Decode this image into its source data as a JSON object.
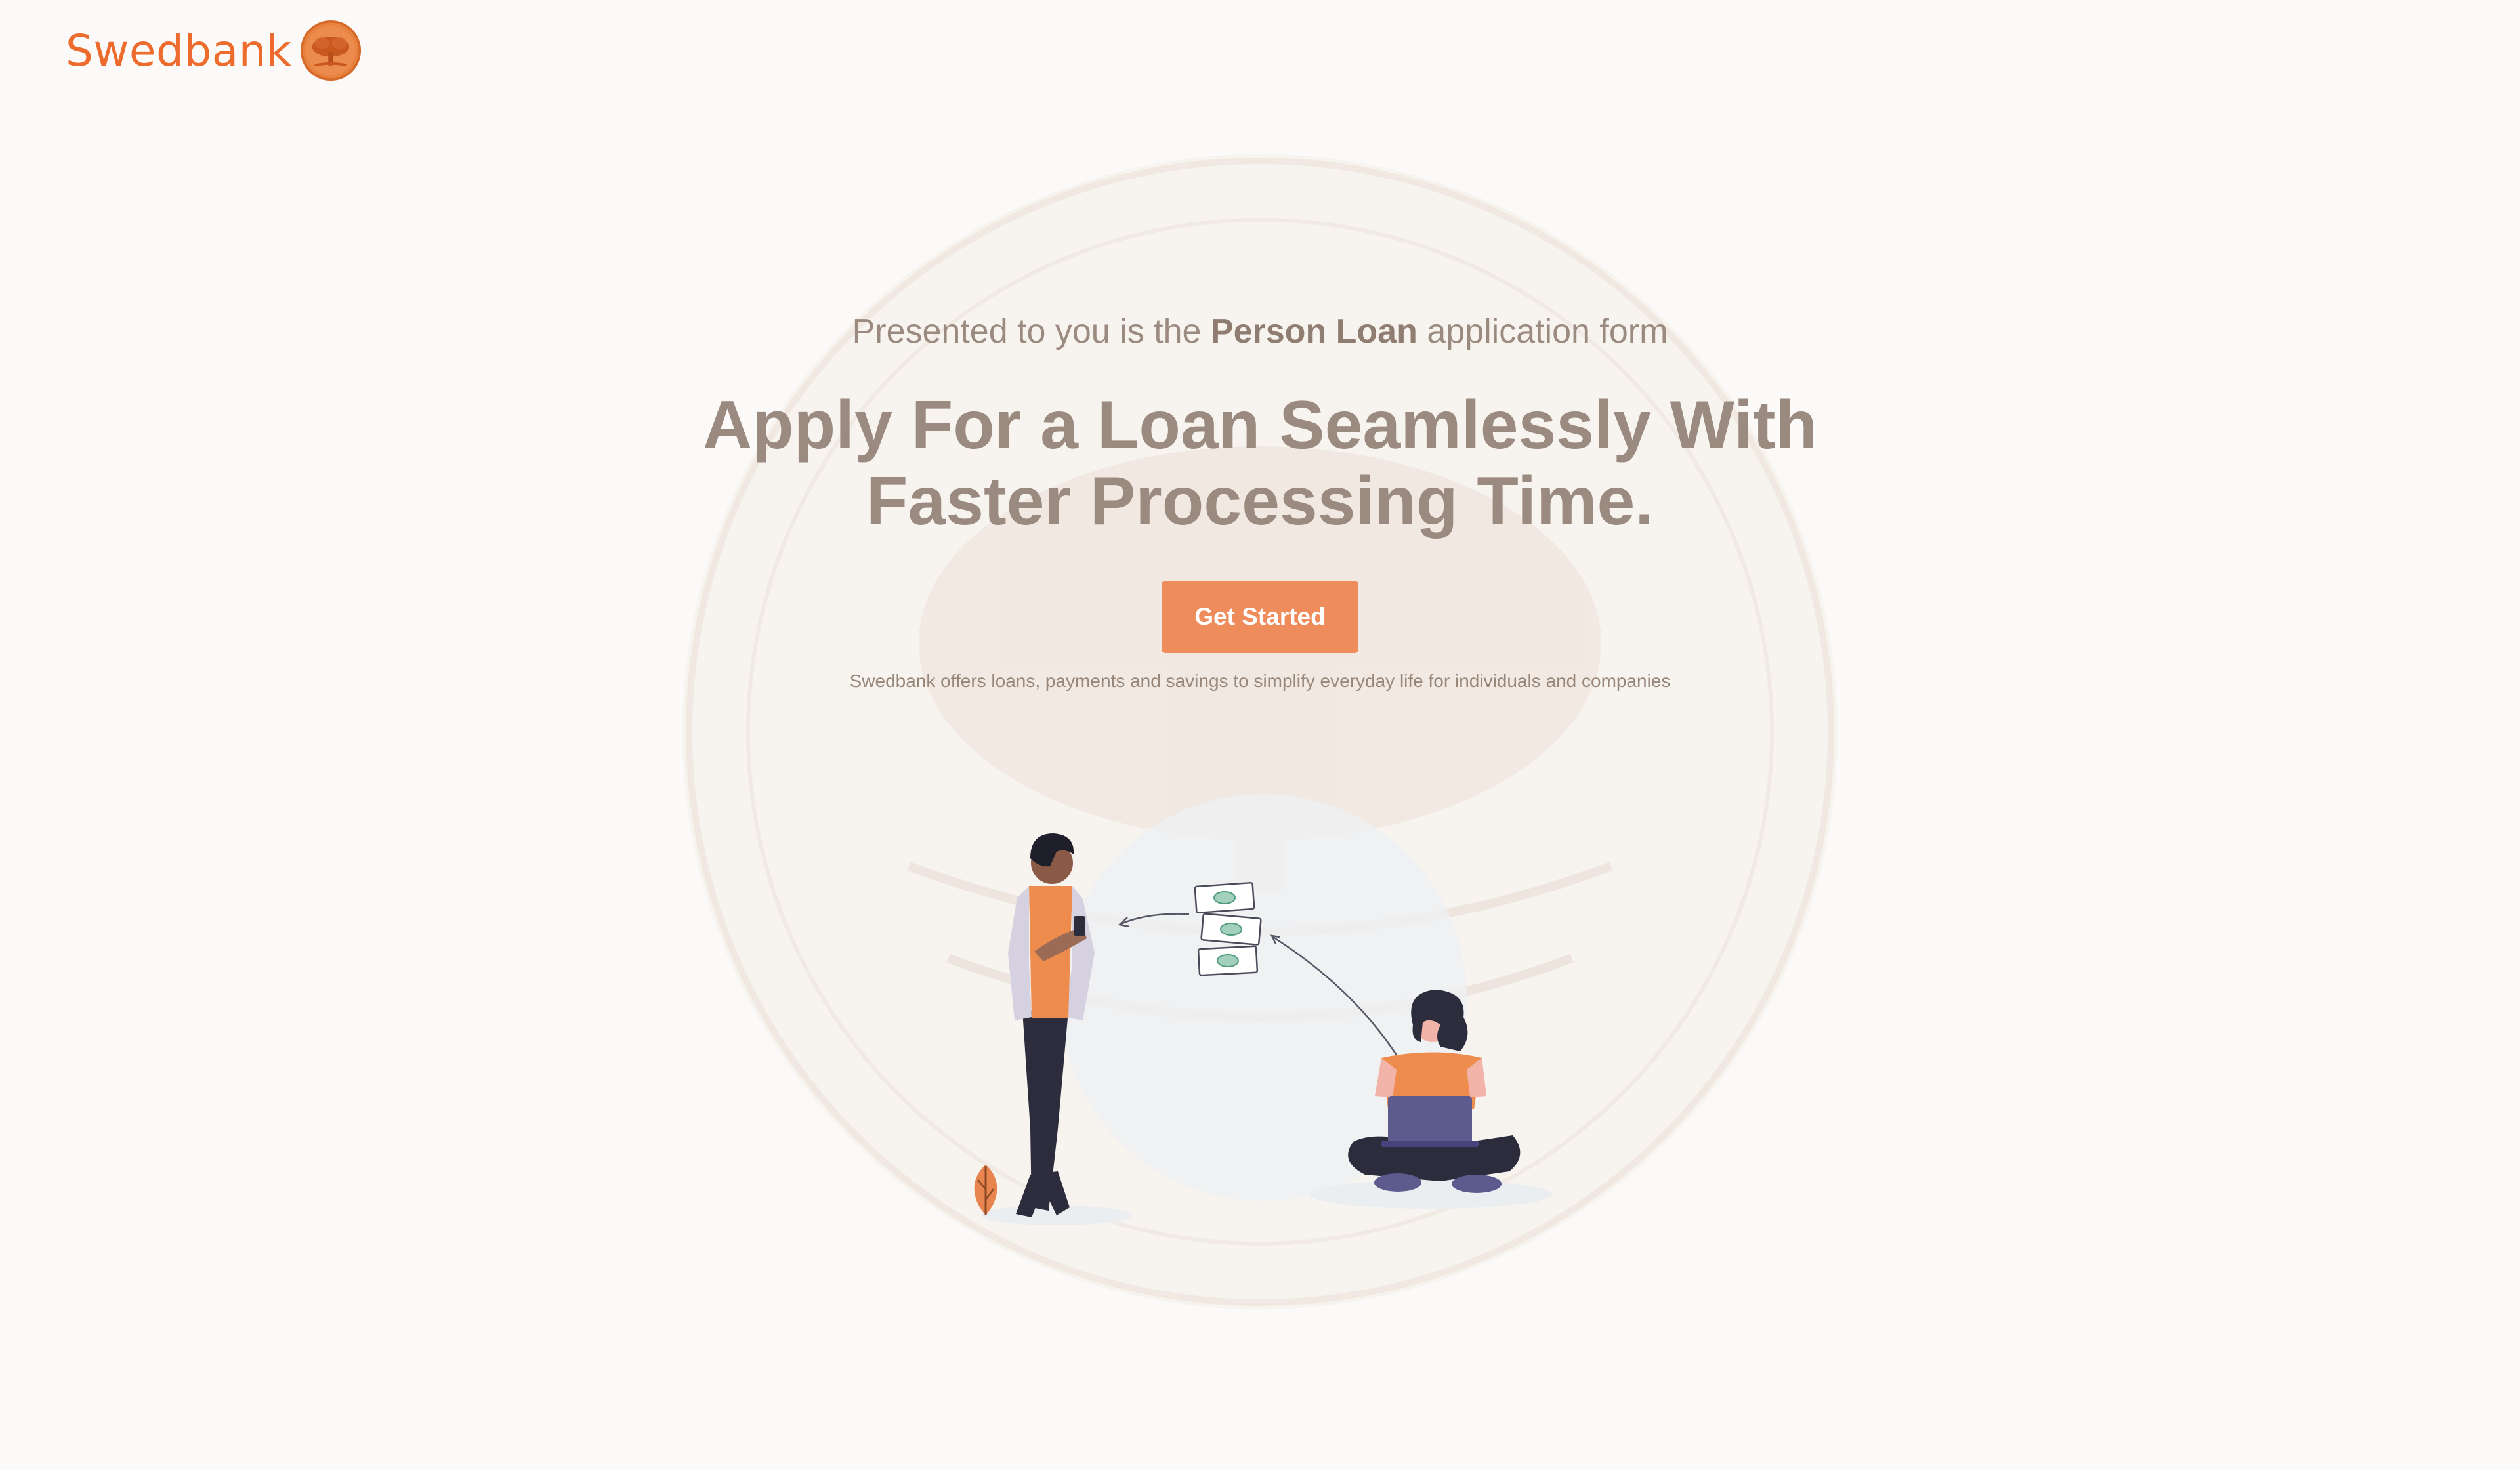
{
  "brand": {
    "name": "Swedbank",
    "accent": "#ec6b2d",
    "logo_icon": "oak-tree-seal-icon"
  },
  "hero": {
    "subtitle_prefix": "Presented to you is the",
    "subtitle_emphasis": "Person Loan",
    "subtitle_suffix": "application form",
    "headline_line1": "Apply For a Loan Seamlessly With",
    "headline_line2": "Faster Processing Time.",
    "cta_label": "Get Started",
    "tagline": "Swedbank offers loans, payments and savings to simplify everyday life for individuals and companies"
  },
  "colors": {
    "background": "#fcfaf8",
    "button": "#ef8c5c",
    "text": "#9a8a7f"
  },
  "illustration": {
    "icon": "money-transfer-illustration"
  }
}
